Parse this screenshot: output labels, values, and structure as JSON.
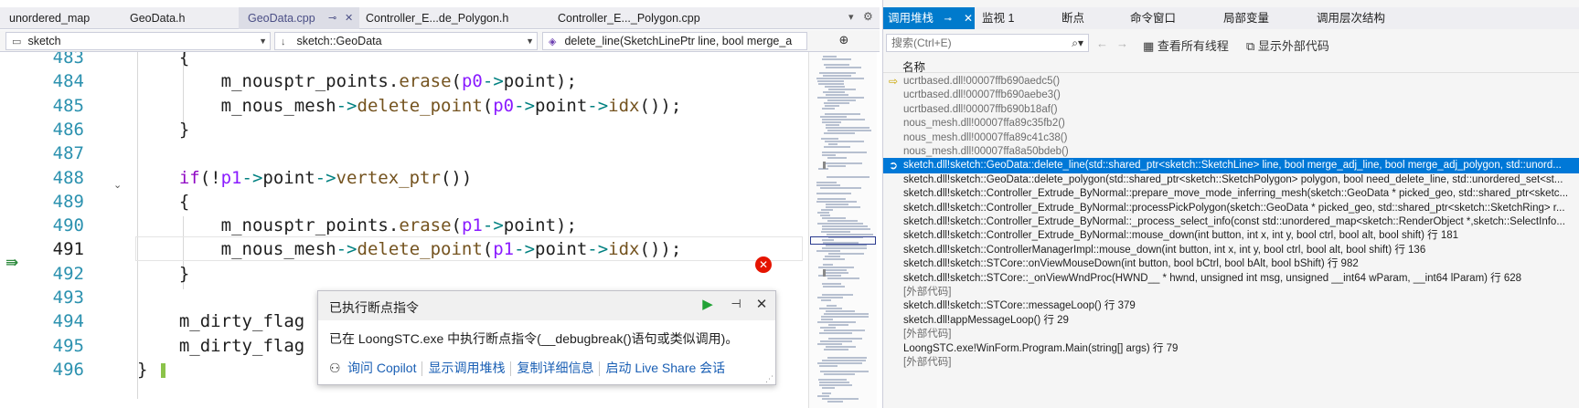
{
  "editor": {
    "tabs": [
      {
        "label": "unordered_map"
      },
      {
        "label": "GeoData.h"
      },
      {
        "label": "GeoData.cpp",
        "pin": "⊸",
        "close": "✕"
      },
      {
        "label": "Controller_E...de_Polygon.h"
      },
      {
        "label": "Controller_E..._Polygon.cpp"
      }
    ],
    "tab_overflow": "▾",
    "settings": "⚙",
    "nav": {
      "project": "sketch",
      "scope": "sketch::GeoData",
      "member": "delete_line(SketchLinePtr line, bool merge_a"
    },
    "code_lines": [
      {
        "num": "483",
        "text": "    {"
      },
      {
        "num": "484",
        "text": "        m_nousptr_points.erase(p0->point);"
      },
      {
        "num": "485",
        "text": "        m_nous_mesh->delete_point(p0->point->idx());"
      },
      {
        "num": "486",
        "text": "    }"
      },
      {
        "num": "487",
        "text": ""
      },
      {
        "num": "488",
        "text": "    if(!p1->point->vertex_ptr())"
      },
      {
        "num": "489",
        "text": "    {"
      },
      {
        "num": "490",
        "text": "        m_nousptr_points.erase(p1->point);"
      },
      {
        "num": "491",
        "text": "        m_nous_mesh->delete_point(p1->point->idx());"
      },
      {
        "num": "492",
        "text": "    }"
      },
      {
        "num": "493",
        "text": ""
      },
      {
        "num": "494",
        "text": "    m_dirty_flag"
      },
      {
        "num": "495",
        "text": "    m_dirty_flag"
      },
      {
        "num": "496",
        "text": "}"
      }
    ],
    "error_glyph": "✕"
  },
  "popup": {
    "title": "已执行断点指令",
    "message": "已在 LoongSTC.exe 中执行断点指令(__debugbreak()语句或类似调用)。",
    "actions": [
      "询问 Copilot",
      "显示调用堆栈",
      "复制详细信息",
      "启动 Live Share 会话"
    ]
  },
  "stack_panel": {
    "tabs": [
      "调用堆栈",
      "监视 1",
      "断点",
      "命令窗口",
      "局部变量",
      "调用层次结构"
    ],
    "search_placeholder": "搜索(Ctrl+E)",
    "show_all_threads": "查看所有线程",
    "show_external_code": "显示外部代码",
    "column_name": "名称",
    "rows": [
      {
        "text": "ucrtbased.dll!00007ffb690aedc5()",
        "dim": true,
        "marker": "yellow"
      },
      {
        "text": "ucrtbased.dll!00007ffb690aebe3()",
        "dim": true
      },
      {
        "text": "ucrtbased.dll!00007ffb690b18af()",
        "dim": true
      },
      {
        "text": "nous_mesh.dll!00007ffa89c35fb2()",
        "dim": true
      },
      {
        "text": "nous_mesh.dll!00007ffa89c41c38()",
        "dim": true
      },
      {
        "text": "nous_mesh.dll!00007ffa8a50bdeb()",
        "dim": true
      },
      {
        "text": "sketch.dll!sketch::GeoData::delete_line(std::shared_ptr<sketch::SketchLine> line, bool merge_adj_line, bool merge_adj_polygon, std::unord...",
        "selected": true,
        "marker": "current"
      },
      {
        "text": "sketch.dll!sketch::GeoData::delete_polygon(std::shared_ptr<sketch::SketchPolygon> polygon, bool need_delete_line, std::unordered_set<st..."
      },
      {
        "text": "sketch.dll!sketch::Controller_Extrude_ByNormal::prepare_move_mode_inferring_mesh(sketch::GeoData * picked_geo, std::shared_ptr<sketc..."
      },
      {
        "text": "sketch.dll!sketch::Controller_Extrude_ByNormal::processPickPolygon(sketch::GeoData * picked_geo, std::shared_ptr<sketch::SketchRing> r..."
      },
      {
        "text": "sketch.dll!sketch::Controller_Extrude_ByNormal::_process_select_info(const std::unordered_map<sketch::RenderObject *,sketch::SelectInfo..."
      },
      {
        "text": "sketch.dll!sketch::Controller_Extrude_ByNormal::mouse_down(int button, int x, int y, bool ctrl, bool alt, bool shift) 行 181"
      },
      {
        "text": "sketch.dll!sketch::ControllerManagerImpl::mouse_down(int button, int x, int y, bool ctrl, bool alt, bool shift) 行 136"
      },
      {
        "text": "sketch.dll!sketch::STCore::onViewMouseDown(int button, bool bCtrl, bool bAlt, bool bShift) 行 982"
      },
      {
        "text": "sketch.dll!sketch::STCore::_onViewWndProc(HWND__ * hwnd, unsigned int msg, unsigned __int64 wParam, __int64 lParam) 行 628"
      },
      {
        "text": "[外部代码]",
        "dim": true
      },
      {
        "text": "sketch.dll!sketch::STCore::messageLoop() 行 379"
      },
      {
        "text": "sketch.dll!appMessageLoop() 行 29"
      },
      {
        "text": "[外部代码]",
        "dim": true
      },
      {
        "text": "LoongSTC.exe!WinForm.Program.Main(string[] args) 行 79"
      },
      {
        "text": "[外部代码]",
        "dim": true
      }
    ]
  }
}
